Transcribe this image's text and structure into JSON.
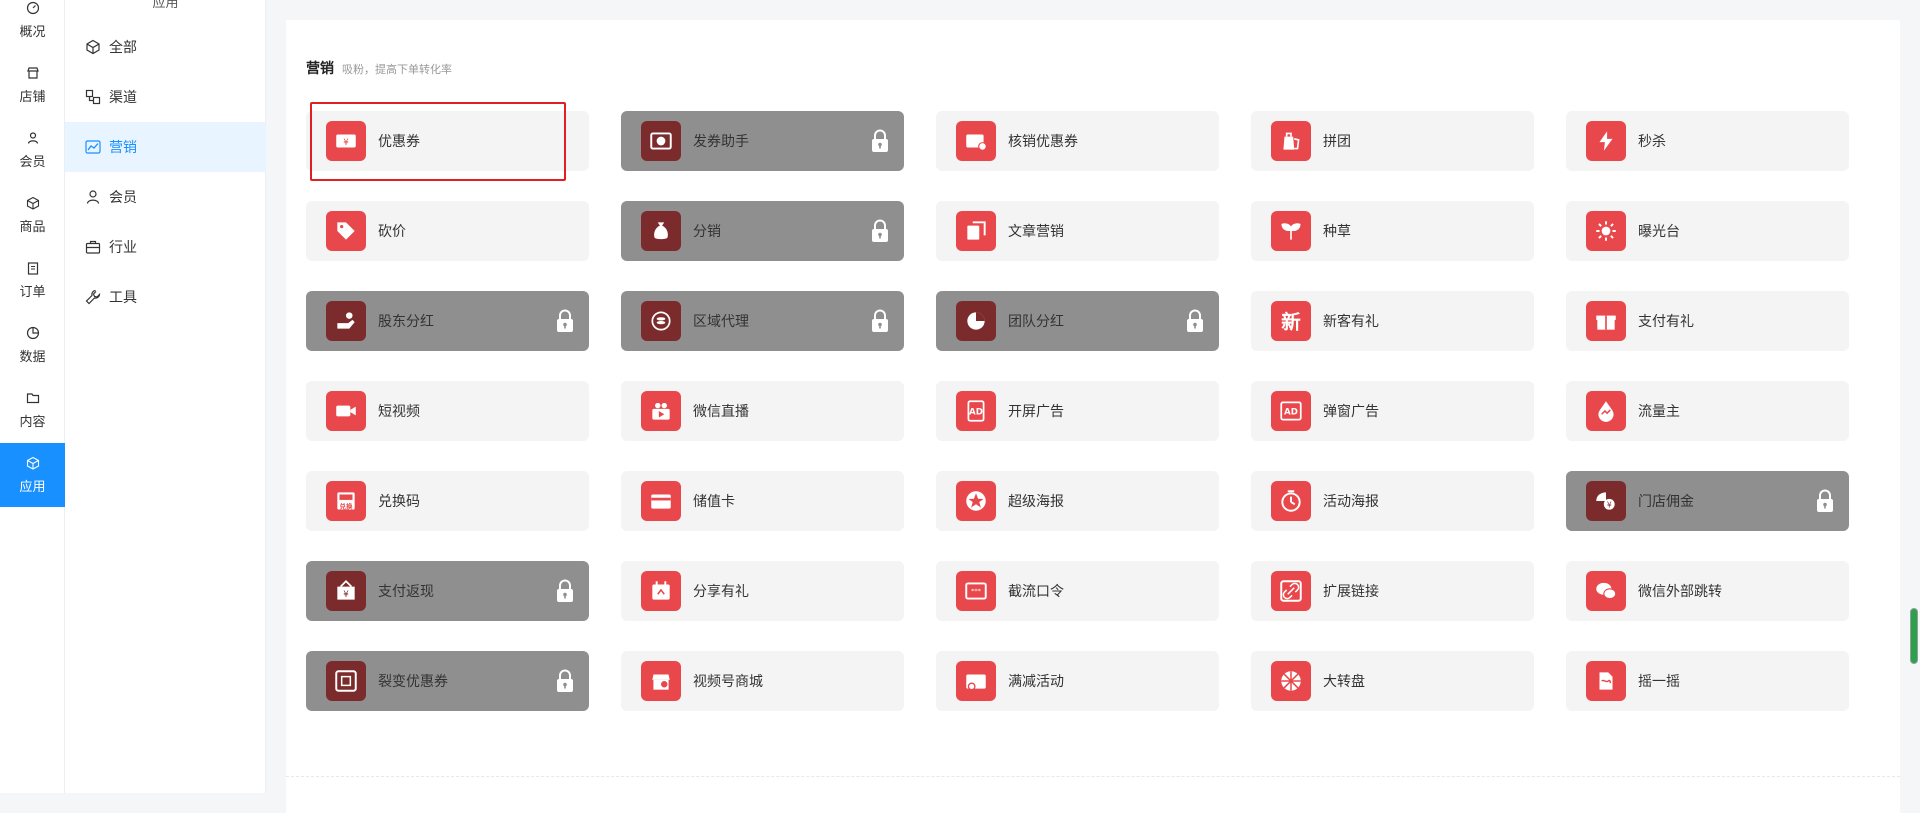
{
  "rail": {
    "items": [
      {
        "label": "概况",
        "icon": "dashboard-icon"
      },
      {
        "label": "店铺",
        "icon": "store-icon"
      },
      {
        "label": "会员",
        "icon": "user-icon"
      },
      {
        "label": "商品",
        "icon": "box-icon"
      },
      {
        "label": "订单",
        "icon": "clipboard-icon"
      },
      {
        "label": "数据",
        "icon": "pie-icon"
      },
      {
        "label": "内容",
        "icon": "folder-icon"
      },
      {
        "label": "应用",
        "icon": "cube-icon",
        "active": true
      }
    ]
  },
  "sidebar": {
    "title": "应用",
    "items": [
      {
        "label": "全部",
        "icon": "cube-icon"
      },
      {
        "label": "渠道",
        "icon": "channel-icon"
      },
      {
        "label": "营销",
        "icon": "trend-icon",
        "active": true
      },
      {
        "label": "会员",
        "icon": "user-icon"
      },
      {
        "label": "行业",
        "icon": "briefcase-icon"
      },
      {
        "label": "工具",
        "icon": "wrench-icon"
      }
    ]
  },
  "section": {
    "title": "营销",
    "subtitle": "吸粉，提高下单转化率"
  },
  "apps": [
    {
      "label": "优惠券",
      "locked": false,
      "icon": "coupon-icon"
    },
    {
      "label": "发券助手",
      "locked": true,
      "icon": "ticket-icon"
    },
    {
      "label": "核销优惠券",
      "locked": false,
      "icon": "verify-coupon-icon"
    },
    {
      "label": "拼团",
      "locked": false,
      "icon": "group-buy-icon"
    },
    {
      "label": "秒杀",
      "locked": false,
      "icon": "lightning-icon"
    },
    {
      "label": "砍价",
      "locked": false,
      "icon": "price-tag-icon"
    },
    {
      "label": "分销",
      "locked": true,
      "icon": "money-bag-icon"
    },
    {
      "label": "文章营销",
      "locked": false,
      "icon": "article-icon"
    },
    {
      "label": "种草",
      "locked": false,
      "icon": "sprout-icon"
    },
    {
      "label": "曝光台",
      "locked": false,
      "icon": "sun-icon"
    },
    {
      "label": "股东分红",
      "locked": true,
      "icon": "dividend-icon"
    },
    {
      "label": "区域代理",
      "locked": true,
      "icon": "coins-icon"
    },
    {
      "label": "团队分红",
      "locked": true,
      "icon": "pie-chart-icon"
    },
    {
      "label": "新客有礼",
      "locked": false,
      "icon": "new-text-icon",
      "glyph": "新"
    },
    {
      "label": "支付有礼",
      "locked": false,
      "icon": "gift-icon"
    },
    {
      "label": "短视频",
      "locked": false,
      "icon": "video-camera-icon"
    },
    {
      "label": "微信直播",
      "locked": false,
      "icon": "live-stream-icon"
    },
    {
      "label": "开屏广告",
      "locked": false,
      "icon": "ad-screen-icon",
      "glyph": "AD"
    },
    {
      "label": "弹窗广告",
      "locked": false,
      "icon": "popup-ad-icon",
      "glyph": "AD"
    },
    {
      "label": "流量主",
      "locked": false,
      "icon": "traffic-drop-icon"
    },
    {
      "label": "兑换码",
      "locked": false,
      "icon": "redeem-code-icon",
      "glyph": "兑换"
    },
    {
      "label": "储值卡",
      "locked": false,
      "icon": "stored-card-icon"
    },
    {
      "label": "超级海报",
      "locked": false,
      "icon": "star-poster-icon"
    },
    {
      "label": "活动海报",
      "locked": false,
      "icon": "timer-icon"
    },
    {
      "label": "门店佣金",
      "locked": true,
      "icon": "commission-icon"
    },
    {
      "label": "支付返现",
      "locked": true,
      "icon": "cashback-icon"
    },
    {
      "label": "分享有礼",
      "locked": false,
      "icon": "share-gift-icon"
    },
    {
      "label": "截流口令",
      "locked": false,
      "icon": "password-icon"
    },
    {
      "label": "扩展链接",
      "locked": false,
      "icon": "link-icon"
    },
    {
      "label": "微信外部跳转",
      "locked": false,
      "icon": "wechat-icon"
    },
    {
      "label": "裂变优惠券",
      "locked": true,
      "icon": "fission-coupon-icon"
    },
    {
      "label": "视频号商城",
      "locked": false,
      "icon": "video-mall-icon"
    },
    {
      "label": "满减活动",
      "locked": false,
      "icon": "discount-icon"
    },
    {
      "label": "大转盘",
      "locked": false,
      "icon": "wheel-icon"
    },
    {
      "label": "摇一摇",
      "locked": false,
      "icon": "shake-icon"
    }
  ],
  "colors": {
    "accent": "#1890ff",
    "icon_bg": "#e8484b",
    "locked_card": "#8f8f8f",
    "locked_icon_bg": "#7c2b2c",
    "highlight_border": "#e02020"
  }
}
